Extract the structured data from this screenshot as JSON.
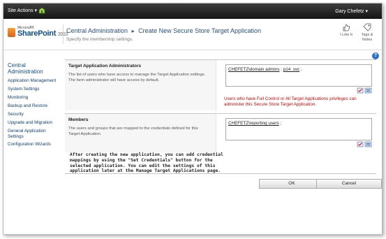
{
  "ribbon": {
    "site_actions": "Site Actions ▾",
    "user": "Gary Chefetz ▾"
  },
  "header": {
    "logo_microsoft": "Microsoft®",
    "logo_product": "SharePoint",
    "logo_year": "2010",
    "breadcrumb_root": "Central Administration",
    "breadcrumb_separator": "▸",
    "breadcrumb_current": "Create New Secure Store Target Application",
    "subtitle": "Specify the membership settings.",
    "like_it": "I Like It",
    "tags_notes_line1": "Tags &",
    "tags_notes_line2": "Notes",
    "help": "?"
  },
  "nav": {
    "header_line1": "Central",
    "header_line2": "Administration",
    "items": [
      "Application Management",
      "System Settings",
      "Monitoring",
      "Backup and Restore",
      "Security",
      "Upgrade and Migration",
      "General Application",
      "Settings",
      "Configuration Wizards"
    ]
  },
  "admins_section": {
    "title": "Target Application Administrators",
    "desc": "The list of users who have access to manage the Target Application settings. The farm administrator will have access by default.",
    "value_user1": "CHEFETZ\\domain admins",
    "value_sep": " ; ",
    "value_user2": "p14_svc",
    "value_end": " ;",
    "warning": "Users who have Full Control or All Target Applications privileges can administer this Secure Store Target Application."
  },
  "members_section": {
    "title": "Members",
    "desc": "The users and groups that are mapped to the credentials defined for this Target Application.",
    "value_user1": "CHEFETZ\\reporting users",
    "value_end": " ;"
  },
  "note": "After creating the new application, you can add credential mappings by using the \"Set Credentials\" button for the selected application. You can edit the settings of this application later at the Manage Target Applications page.",
  "buttons": {
    "ok": "OK",
    "cancel": "Cancel"
  },
  "colors": {
    "ribbon": "#1f1f1f",
    "link": "#0d4d8c",
    "warning": "#d40000"
  }
}
